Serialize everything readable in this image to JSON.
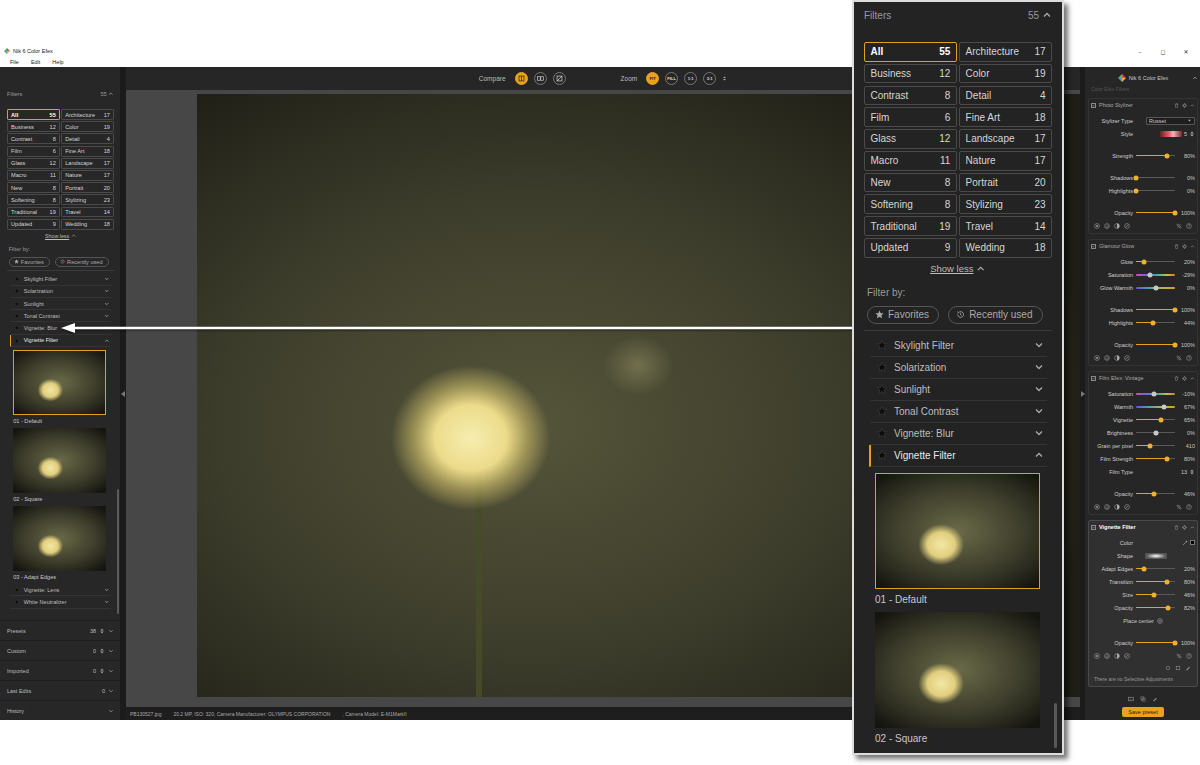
{
  "window": {
    "title": "Nik 6 Color Efex",
    "controls": [
      "–",
      "◻",
      "✕"
    ]
  },
  "menu": [
    "File",
    "Edit",
    "Help"
  ],
  "filters_panel": {
    "title": "Filters",
    "count": "55",
    "expanded": true,
    "categories": [
      {
        "label": "All",
        "count": "55",
        "selected": true
      },
      {
        "label": "Architecture",
        "count": "17",
        "selected": false
      },
      {
        "label": "Business",
        "count": "12",
        "selected": false
      },
      {
        "label": "Color",
        "count": "19",
        "selected": false
      },
      {
        "label": "Contrast",
        "count": "8",
        "selected": false
      },
      {
        "label": "Detail",
        "count": "4",
        "selected": false
      },
      {
        "label": "Film",
        "count": "6",
        "selected": false
      },
      {
        "label": "Fine Art",
        "count": "18",
        "selected": false
      },
      {
        "label": "Glass",
        "count": "12",
        "selected": false
      },
      {
        "label": "Landscape",
        "count": "17",
        "selected": false
      },
      {
        "label": "Macro",
        "count": "11",
        "selected": false
      },
      {
        "label": "Nature",
        "count": "17",
        "selected": false
      },
      {
        "label": "New",
        "count": "8",
        "selected": false
      },
      {
        "label": "Portrait",
        "count": "20",
        "selected": false
      },
      {
        "label": "Softening",
        "count": "8",
        "selected": false
      },
      {
        "label": "Stylizing",
        "count": "23",
        "selected": false
      },
      {
        "label": "Traditional",
        "count": "19",
        "selected": false
      },
      {
        "label": "Travel",
        "count": "14",
        "selected": false
      },
      {
        "label": "Updated",
        "count": "9",
        "selected": false
      },
      {
        "label": "Wedding",
        "count": "18",
        "selected": false
      }
    ],
    "toggle": "Show less",
    "filter_by": "Filter by:",
    "quick_filters": [
      {
        "label": "Favorites",
        "kind": "favorites",
        "selected": false
      },
      {
        "label": "Recently used",
        "kind": "recent",
        "selected": false
      }
    ],
    "items": [
      {
        "label": "Skylight Filter",
        "expanded": false,
        "selected": false
      },
      {
        "label": "Solarization",
        "expanded": false,
        "selected": false
      },
      {
        "label": "Sunlight",
        "expanded": false,
        "selected": false
      },
      {
        "label": "Tonal Contrast",
        "expanded": false,
        "selected": false
      },
      {
        "label": "Vignette: Blur",
        "expanded": false,
        "selected": false
      },
      {
        "label": "Vignette Filter",
        "expanded": true,
        "selected": true,
        "presets": [
          {
            "label": "01 - Default",
            "selected": true
          },
          {
            "label": "02 - Square",
            "selected": false
          },
          {
            "label": "03 - Adapt Edges",
            "selected": false
          }
        ]
      },
      {
        "label": "Vignette: Lens",
        "expanded": false,
        "selected": false
      },
      {
        "label": "White Neutralizer",
        "expanded": false,
        "selected": false
      }
    ],
    "sections": [
      {
        "label": "Presets",
        "count": "38",
        "sortable": true,
        "expanded": false
      },
      {
        "label": "Custom",
        "count": "0",
        "sortable": true,
        "expanded": false
      },
      {
        "label": "Imported",
        "count": "0",
        "sortable": true,
        "expanded": false
      },
      {
        "label": "Last Edits",
        "count": "0",
        "sortable": false,
        "expanded": false
      },
      {
        "label": "History",
        "sortable": false,
        "expanded": false
      }
    ]
  },
  "toolbar": {
    "compare": {
      "label": "Compare",
      "buttons": [
        {
          "kind": "split",
          "selected": true
        },
        {
          "kind": "side-by-side",
          "selected": false
        },
        {
          "kind": "original",
          "selected": false
        }
      ]
    },
    "zoom": {
      "label": "Zoom",
      "buttons": [
        {
          "label": "FIT",
          "selected": true
        },
        {
          "label": "FILL",
          "selected": false
        },
        {
          "label": "1:1",
          "selected": false
        },
        {
          "label": "3:1",
          "selected": false
        }
      ]
    }
  },
  "status_bar": {
    "file": "PB130527.jpg",
    "details": "20.2 MP, ISO: 320, Camera Manufacturer: OLYMPUS CORPORATION",
    "camera": ", Camera Model: E-M1MarkII"
  },
  "adjustments": {
    "brand": "Nik 6 Color Efex",
    "heading": "Color Efex Filters",
    "filters": [
      {
        "name": "Photo Stylizer",
        "enabled": true,
        "active": false,
        "expanded": true,
        "groups": [
          [
            {
              "kind": "dropdown",
              "label": "Stylizer Type",
              "value": "Russet"
            },
            {
              "kind": "style",
              "label": "Style",
              "value": "5"
            }
          ],
          [
            {
              "kind": "slider",
              "label": "Strength",
              "value": "80%",
              "level": 0.8
            }
          ],
          [
            {
              "kind": "slider",
              "label": "Shadows",
              "value": "0%",
              "level": 0
            },
            {
              "kind": "slider",
              "label": "Highlights",
              "value": "0%",
              "level": 0
            }
          ],
          [
            {
              "kind": "slider",
              "label": "Opacity",
              "value": "100%",
              "level": 1
            }
          ]
        ]
      },
      {
        "name": "Glamour Glow",
        "enabled": true,
        "active": false,
        "expanded": true,
        "groups": [
          [
            {
              "kind": "slider",
              "label": "Glow",
              "value": "20%",
              "level": 0.2
            },
            {
              "kind": "saturation",
              "label": "Saturation",
              "value": "-29%",
              "level": 0.36
            },
            {
              "kind": "warmth",
              "label": "Glow Warmth",
              "value": "0%",
              "level": 0.5
            }
          ],
          [
            {
              "kind": "slider",
              "label": "Shadows",
              "value": "100%",
              "level": 1
            },
            {
              "kind": "slider",
              "label": "Highlights",
              "value": "44%",
              "level": 0.44
            }
          ],
          [
            {
              "kind": "slider",
              "label": "Opacity",
              "value": "100%",
              "level": 1
            }
          ]
        ]
      },
      {
        "name": "Film Efex: Vintage",
        "enabled": true,
        "active": false,
        "expanded": true,
        "groups": [
          [
            {
              "kind": "saturation",
              "label": "Saturation",
              "value": "-10%",
              "level": 0.45
            },
            {
              "kind": "warmth",
              "label": "Warmth",
              "value": "67%",
              "level": 0.72
            },
            {
              "kind": "slider",
              "label": "Vignette",
              "value": "65%",
              "level": 0.65
            },
            {
              "kind": "bipolar",
              "label": "Brightness",
              "value": "0%",
              "level": 0.5
            },
            {
              "kind": "slider",
              "label": "Grain per pixel",
              "value": "410",
              "level": 0.35
            },
            {
              "kind": "slider",
              "label": "Film Strength",
              "value": "80%",
              "level": 0.8
            },
            {
              "kind": "stepper",
              "label": "Film Type",
              "value": "13"
            }
          ],
          [
            {
              "kind": "slider",
              "label": "Opacity",
              "value": "46%",
              "level": 0.46
            }
          ]
        ]
      },
      {
        "name": "Vignette Filter",
        "enabled": true,
        "active": true,
        "expanded": true,
        "groups": [
          [
            {
              "kind": "color",
              "label": "Color",
              "color": "#000000"
            },
            {
              "kind": "shape",
              "label": "Shape"
            },
            {
              "kind": "slider",
              "label": "Adapt Edges",
              "value": "20%",
              "level": 0.2
            },
            {
              "kind": "slider",
              "label": "Transition",
              "value": "80%",
              "level": 0.8
            },
            {
              "kind": "slider",
              "label": "Size",
              "value": "46%",
              "level": 0.46
            },
            {
              "kind": "slider",
              "label": "Opacity",
              "value": "82%",
              "level": 0.82
            },
            {
              "kind": "button",
              "label": "Place center"
            }
          ],
          [
            {
              "kind": "slider",
              "label": "Opacity",
              "value": "100%",
              "level": 1
            }
          ]
        ],
        "note": "There are no Selective Adjustments"
      }
    ],
    "save_button": "Save preset"
  }
}
